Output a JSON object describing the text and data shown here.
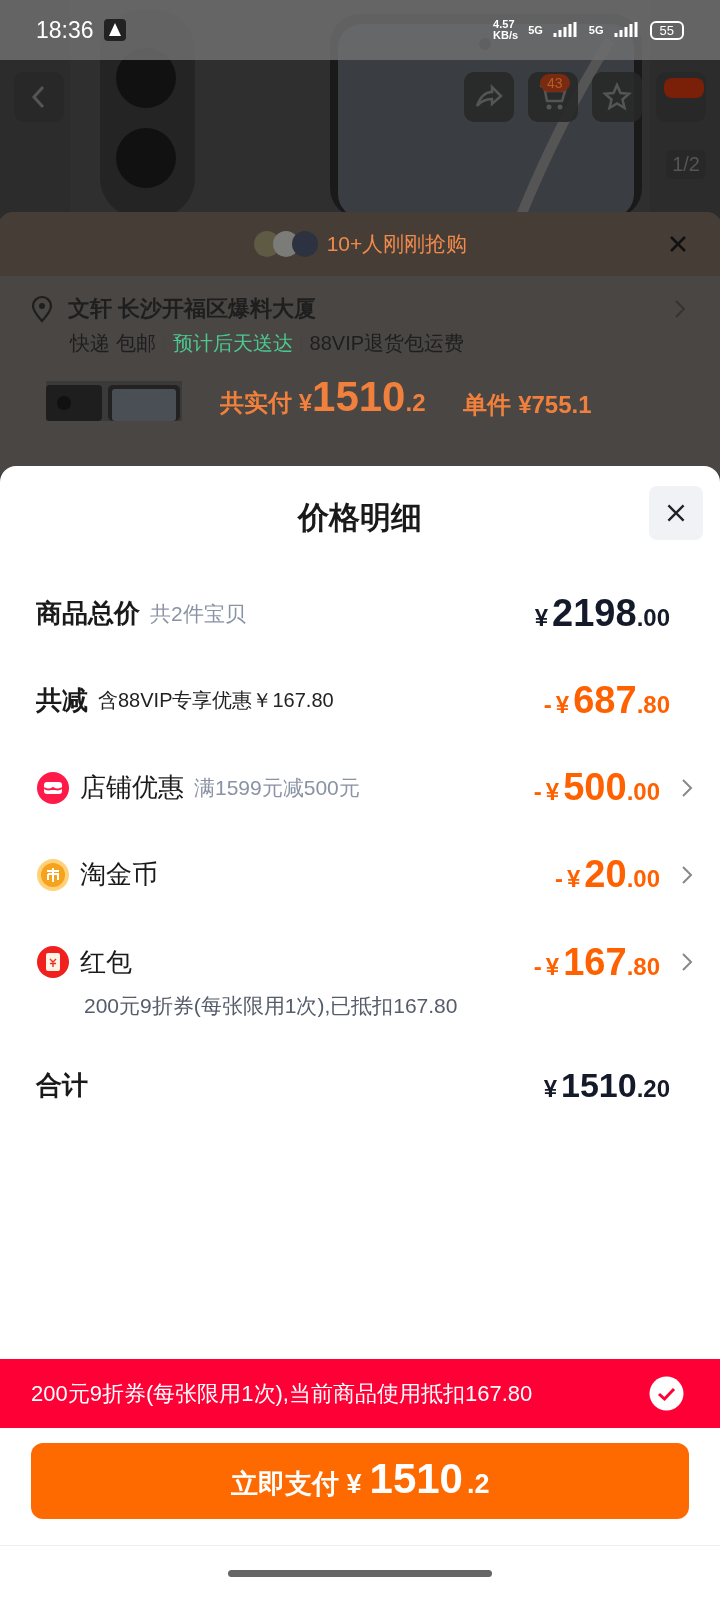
{
  "status_bar": {
    "time": "18:36",
    "speed_value": "4.57",
    "speed_unit": "KB/s",
    "network_1": "5G",
    "network_2": "5G",
    "battery": "55"
  },
  "product_page": {
    "cart_badge": "43",
    "image_counter": "1/2",
    "buyers_banner": {
      "text": "10+人刚刚抢购"
    },
    "address": "文轩 长沙开福区爆料大厦",
    "delivery": [
      {
        "text": "快递 包邮",
        "kind": "plain"
      },
      {
        "text": "预计后天送达",
        "kind": "highlight"
      },
      {
        "text": "88VIP退货包运费",
        "kind": "plain"
      }
    ],
    "summary": {
      "label": "共实付",
      "yen": "¥",
      "main": "1510",
      "fraction": ".2",
      "unit_price": "单件 ¥755.1"
    }
  },
  "price_detail": {
    "title": "价格明细",
    "rows": [
      {
        "kind": "total",
        "label": "商品总价",
        "note": "共2件宝贝",
        "amount": {
          "yen": "¥",
          "main": "2198",
          "fraction": ".00"
        },
        "arrow": false
      },
      {
        "kind": "discount",
        "label": "共减",
        "note": "含88VIP专享优惠￥167.80",
        "amount": {
          "sign": "-",
          "yen": "¥",
          "main": "687",
          "fraction": ".80"
        },
        "arrow": false
      },
      {
        "kind": "shop",
        "label": "店铺优惠",
        "note": "满1599元减500元",
        "amount": {
          "sign": "-",
          "yen": "¥",
          "main": "500",
          "fraction": ".00"
        },
        "arrow": true
      },
      {
        "kind": "coin",
        "label": "淘金币",
        "amount": {
          "sign": "-",
          "yen": "¥",
          "main": "20",
          "fraction": ".00"
        },
        "arrow": true
      },
      {
        "kind": "red_packet",
        "label": "红包",
        "detail": "200元9折券(每张限用1次),已抵扣167.80",
        "amount": {
          "sign": "-",
          "yen": "¥",
          "main": "167",
          "fraction": ".80"
        },
        "arrow": true
      },
      {
        "kind": "sum",
        "label": "合计",
        "amount": {
          "yen": "¥",
          "main": "1510",
          "fraction": ".20"
        },
        "arrow": false
      }
    ],
    "coupon_bar": {
      "text": "200元9折券(每张限用1次),当前商品使用抵扣167.80",
      "checked": true
    },
    "pay_button": {
      "label": "立即支付",
      "yen": "¥",
      "main": "1510",
      "fraction": ".2"
    }
  }
}
